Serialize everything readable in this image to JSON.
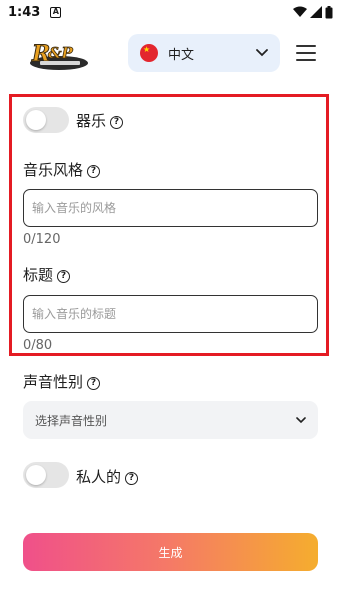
{
  "status_bar": {
    "time": "1:43",
    "app_icon": "A"
  },
  "header": {
    "logo_text": "RAP",
    "language": {
      "label": "中文",
      "flag": "china-flag"
    }
  },
  "form": {
    "instrumental": {
      "label": "器乐",
      "enabled": false
    },
    "style": {
      "label": "音乐风格",
      "placeholder": "输入音乐的风格",
      "counter": "0/120"
    },
    "title": {
      "label": "标题",
      "placeholder": "输入音乐的标题",
      "counter": "0/80"
    },
    "gender": {
      "label": "声音性别",
      "placeholder": "选择声音性别"
    },
    "private": {
      "label": "私人的",
      "enabled": false
    },
    "generate_label": "生成"
  },
  "colors": {
    "highlight": "#e41b23",
    "button_gradient": [
      "#f0508a",
      "#f5ad2e"
    ]
  }
}
